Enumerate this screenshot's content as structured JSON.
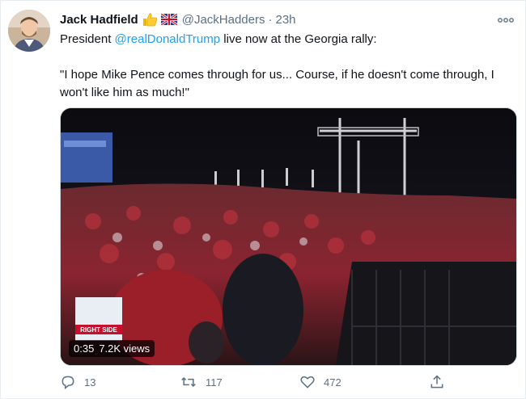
{
  "author": {
    "name": "Jack Hadfield",
    "handle": "@JackHadders",
    "separator": "·",
    "time": "23h"
  },
  "tweet": {
    "prefix": "President ",
    "mention": "@realDonaldTrump",
    "suffix": " live now at the Georgia rally:",
    "quote": "\"I hope Mike Pence comes through for us... Course, if he doesn't come through, I won't like him as much!\""
  },
  "media": {
    "duration": "0:35",
    "views": "7.2K views",
    "watermark_text": "RIGHT SIDE"
  },
  "actions": {
    "replies": "13",
    "retweets": "117",
    "likes": "472"
  },
  "colors": {
    "accent": "#1da1f2",
    "secondary_text": "#5b7083",
    "like": "#5b7083"
  },
  "icons": [
    "more-icon",
    "thumbs-up-icon",
    "uk-flag-icon",
    "reply-icon",
    "retweet-icon",
    "like-icon",
    "share-icon"
  ]
}
